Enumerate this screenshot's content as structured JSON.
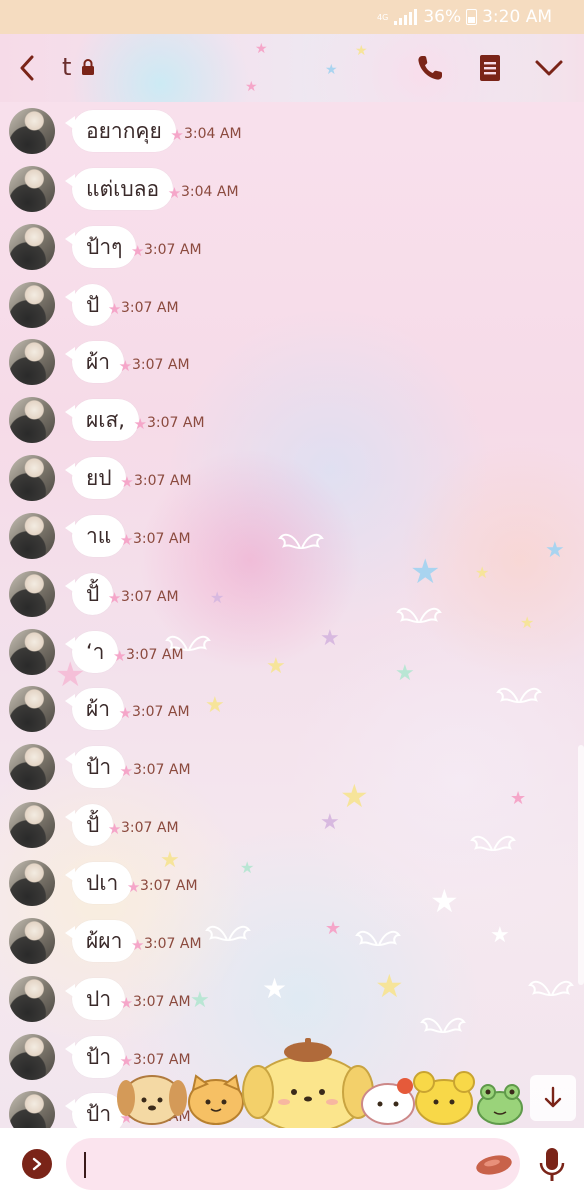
{
  "status_bar": {
    "network_label": "4G",
    "battery": "36%",
    "time": "3:20 AM"
  },
  "header": {
    "chat_name": "t",
    "icons": [
      "back-arrow-icon",
      "lock-icon",
      "phone-icon",
      "notes-icon",
      "chevron-down-icon"
    ]
  },
  "messages": [
    {
      "text": "อยากคุย",
      "time": "3:04 AM"
    },
    {
      "text": "แต่เบลอ",
      "time": "3:04 AM"
    },
    {
      "text": "ป้าๆ",
      "time": "3:07 AM"
    },
    {
      "text": "ปั",
      "time": "3:07 AM"
    },
    {
      "text": "ผ้า",
      "time": "3:07 AM"
    },
    {
      "text": "ผเส,",
      "time": "3:07 AM"
    },
    {
      "text": "ยป",
      "time": "3:07 AM"
    },
    {
      "text": "าแ",
      "time": "3:07 AM"
    },
    {
      "text": "ปั้",
      "time": "3:07 AM"
    },
    {
      "text": "ʻา",
      "time": "3:07 AM"
    },
    {
      "text": "ผ้า",
      "time": "3:07 AM"
    },
    {
      "text": "ป้า",
      "time": "3:07 AM"
    },
    {
      "text": "ปั้",
      "time": "3:07 AM"
    },
    {
      "text": "ปเา",
      "time": "3:07 AM"
    },
    {
      "text": "ผ้ผา",
      "time": "3:07 AM"
    },
    {
      "text": "ปา",
      "time": "3:07 AM"
    },
    {
      "text": "ป้า",
      "time": "3:07 AM"
    },
    {
      "text": "ป้า",
      "time": "3:07 AM"
    }
  ],
  "input": {
    "value": "",
    "placeholder": ""
  },
  "colors": {
    "status_bar_bg": "#f5dcc0",
    "header_icon": "#7a2418",
    "time_text": "#8b4a3e",
    "bubble": "#ffffff",
    "input_bg": "#fbe4ee"
  }
}
